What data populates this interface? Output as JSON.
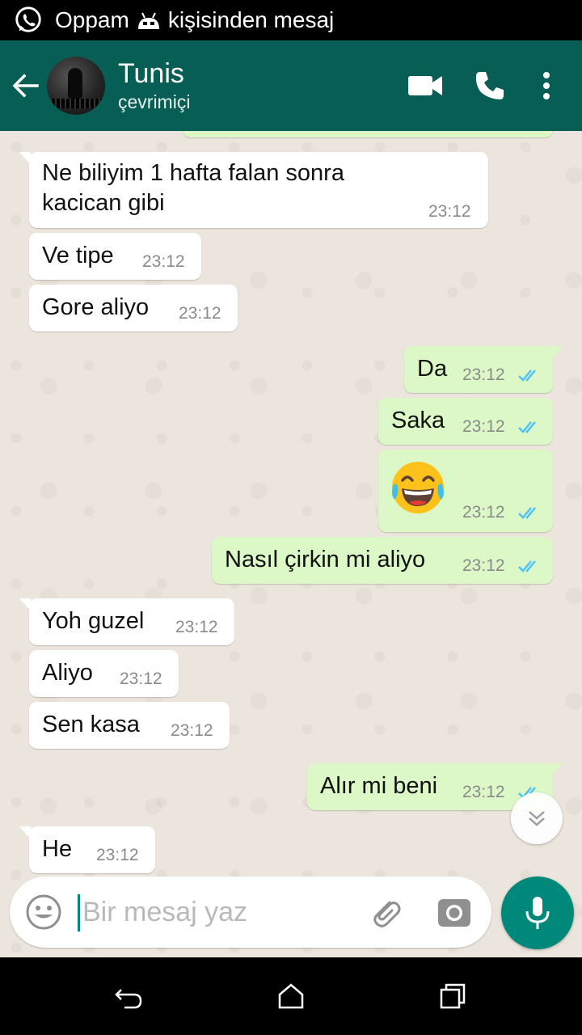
{
  "status_bar": {
    "notification_text": "Oppam 🤖 kişisinden mesaj",
    "sender": "Oppam",
    "suffix": "kişisinden mesaj"
  },
  "header": {
    "contact_name": "Tunis",
    "contact_status": "çevrimiçi"
  },
  "icons": {
    "status": [
      "whatsapp-icon",
      "android-icon"
    ],
    "header": [
      "back-arrow-icon",
      "video-call-icon",
      "phone-icon",
      "more-vert-icon"
    ],
    "input": [
      "emoji-icon",
      "attach-icon",
      "camera-icon",
      "mic-icon"
    ],
    "nav": [
      "nav-back-icon",
      "nav-home-icon",
      "nav-recents-icon"
    ],
    "chat": [
      "double-check-icon",
      "chevron-double-down-icon"
    ]
  },
  "colors": {
    "header": "#075e54",
    "outgoing": "#dcf8c6",
    "incoming": "#ffffff",
    "accent": "#00897b",
    "read_ticks": "#4fc3f7"
  },
  "messages": [
    {
      "dir": "in",
      "text_lines": [
        "Ne biliyim 1 hafta falan sonra",
        "kacican gibi"
      ],
      "time": "23:12"
    },
    {
      "dir": "in",
      "text": "Ve tipe",
      "time": "23:12"
    },
    {
      "dir": "in",
      "text": "Gore aliyo",
      "time": "23:12"
    },
    {
      "dir": "out",
      "text": "Da",
      "time": "23:12",
      "read": true
    },
    {
      "dir": "out",
      "text": "Saka",
      "time": "23:12",
      "read": true
    },
    {
      "dir": "out",
      "emoji": "face-with-tears-of-joy",
      "time": "23:12",
      "read": true
    },
    {
      "dir": "out",
      "text": "Nasıl çirkin mi aliyo",
      "time": "23:12",
      "read": true
    },
    {
      "dir": "in",
      "text": "Yoh guzel",
      "time": "23:12"
    },
    {
      "dir": "in",
      "text": "Aliyo",
      "time": "23:12"
    },
    {
      "dir": "in",
      "text": "Sen kasa",
      "time": "23:12"
    },
    {
      "dir": "out",
      "text": "Alır mi beni",
      "time": "23:12",
      "read": true
    },
    {
      "dir": "in",
      "text": "He",
      "time": "23:12"
    }
  ],
  "composer": {
    "placeholder": "Bir mesaj yaz",
    "value": ""
  }
}
